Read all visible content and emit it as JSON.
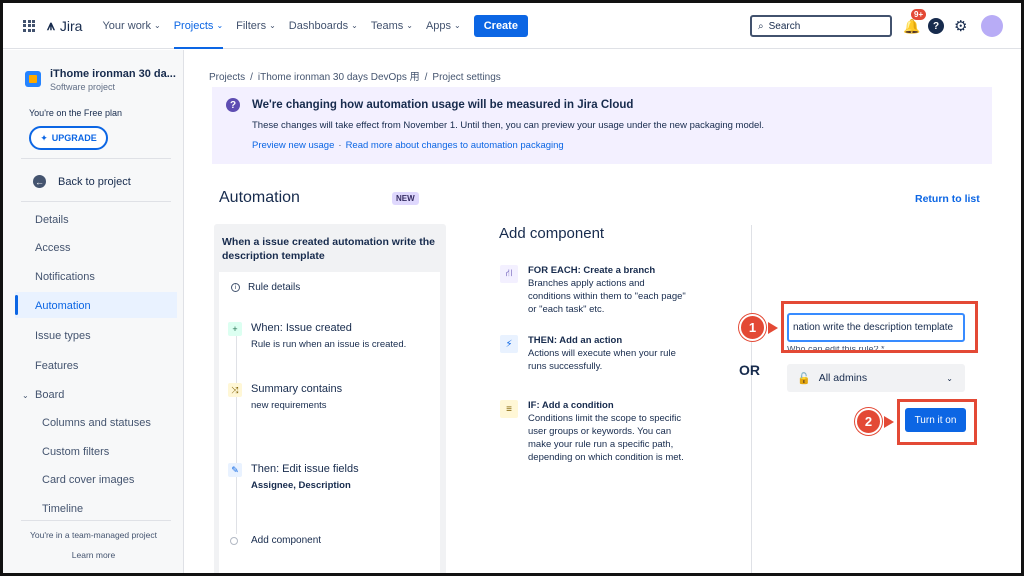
{
  "nav": {
    "logo": "Jira",
    "items": [
      "Your work",
      "Projects",
      "Filters",
      "Dashboards",
      "Teams",
      "Apps"
    ],
    "create": "Create",
    "search_placeholder": "Search",
    "notif_badge": "9+"
  },
  "sidebar": {
    "project_name": "iThome ironman 30 da...",
    "project_type": "Software project",
    "plan": "You're on the Free plan",
    "upgrade": "UPGRADE",
    "back": "Back to project",
    "items": [
      "Details",
      "Access",
      "Notifications",
      "Automation",
      "Issue types",
      "Features",
      "Board"
    ],
    "board_items": [
      "Columns and statuses",
      "Custom filters",
      "Card cover images",
      "Timeline"
    ],
    "team_note": "You're in a team-managed project",
    "learn_more": "Learn more"
  },
  "breadcrumb": [
    "Projects",
    "iThome ironman 30 days DevOps 用",
    "Project settings"
  ],
  "banner": {
    "title": "We're changing how automation usage will be measured in Jira Cloud",
    "text": "These changes will take effect from November 1. Until then, you can preview your usage under the new packaging model.",
    "link1": "Preview new usage",
    "link2": "Read more about changes to automation packaging"
  },
  "automation": {
    "title": "Automation",
    "badge": "NEW",
    "return": "Return to list"
  },
  "rule": {
    "title": "When a issue created automation write the description template",
    "details": "Rule details",
    "steps": [
      {
        "title": "When: Issue created",
        "sub": "Rule is run when an issue is created."
      },
      {
        "title": "Summary contains",
        "sub": "new requirements"
      },
      {
        "title": "Then: Edit issue fields",
        "sub": "Assignee, Description"
      }
    ],
    "add_component": "Add component"
  },
  "add_component": {
    "title": "Add component",
    "items": [
      {
        "title": "FOR EACH: Create a branch",
        "desc": "Branches apply actions and conditions within them to \"each page\" or \"each task\" etc."
      },
      {
        "title": "THEN: Add an action",
        "desc": "Actions will execute when your rule runs successfully."
      },
      {
        "title": "IF: Add a condition",
        "desc": "Conditions limit the scope to specific user groups or keywords. You can make your rule run a specific path, depending on which condition is met."
      }
    ]
  },
  "publish": {
    "or": "OR",
    "name_value": "nation write the description template",
    "who_label": "Who can edit this rule? *",
    "who_value": "All admins",
    "turn_on": "Turn it on",
    "step1": "1",
    "step2": "2"
  },
  "colors": {
    "accent": "#0c66e4",
    "highlight": "#e34935",
    "banner_bg": "#f3f0ff"
  }
}
